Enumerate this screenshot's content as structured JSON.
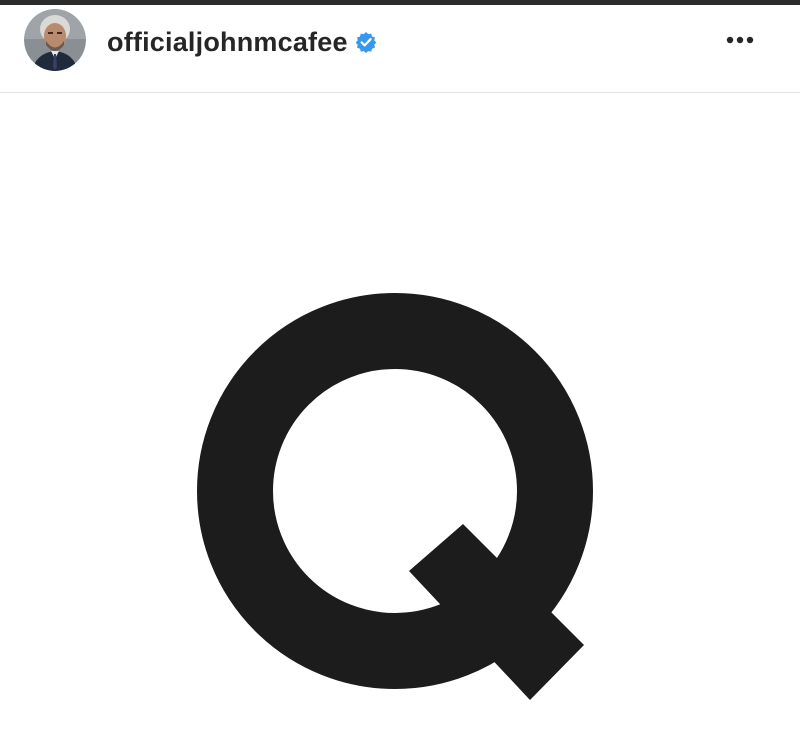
{
  "post": {
    "username": "officialjohnmcafee",
    "verified": true,
    "avatar_icon": "profile-photo-avatar",
    "more_icon": "more-options-icon",
    "image": {
      "letter": "Q",
      "letter_color": "#1c1c1c",
      "background": "#ffffff"
    }
  },
  "colors": {
    "verified_badge": "#3897f0",
    "username_text": "#262626",
    "top_bar": "#2b2b2b"
  }
}
